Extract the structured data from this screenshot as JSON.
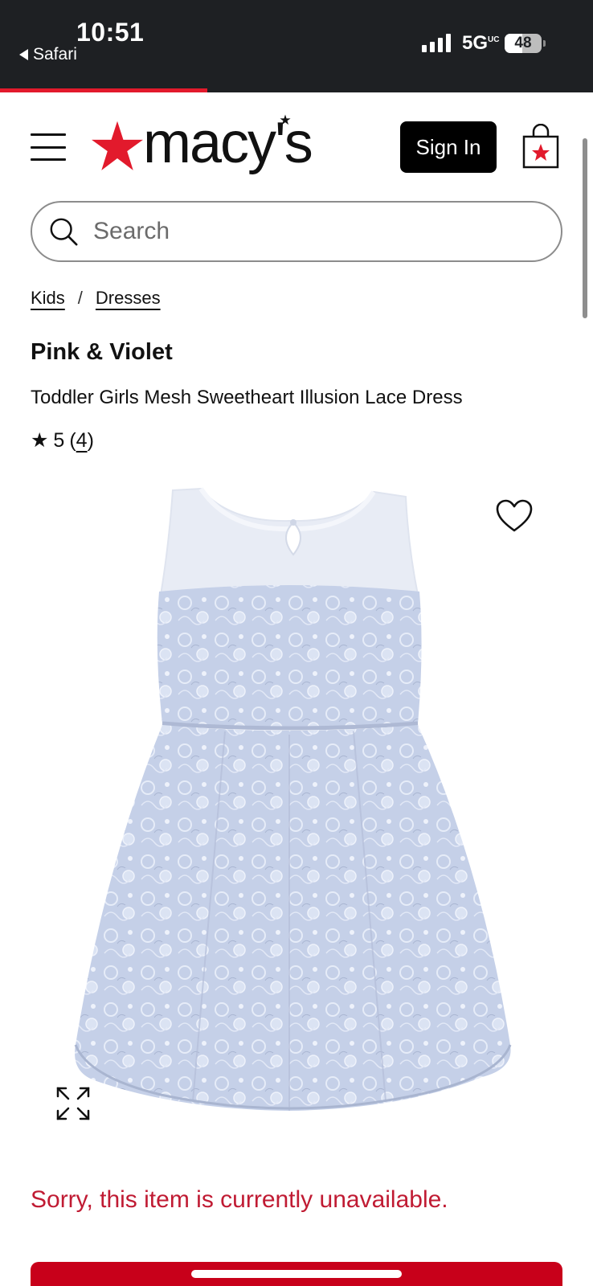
{
  "status_bar": {
    "time": "10:51",
    "back_label": "Safari",
    "network": "5G",
    "network_sup": "UC",
    "battery": "48",
    "battery_fraction": 0.48
  },
  "page_load_progress": 0.35,
  "header": {
    "menu_icon": "hamburger-menu-icon",
    "logo_text": "macy's",
    "brand_color": "#e21a2c",
    "signin_label": "Sign In",
    "bag_icon": "shopping-bag-icon"
  },
  "search": {
    "placeholder": "Search",
    "value": ""
  },
  "breadcrumb": {
    "items": [
      "Kids",
      "Dresses"
    ],
    "separator": "/"
  },
  "product": {
    "brand": "Pink & Violet",
    "name": "Toddler Girls Mesh Sweetheart Illusion Lace Dress",
    "rating_star": "★",
    "rating": "5",
    "review_count": "4",
    "image_icon": "light-blue-lace-dress-image",
    "wishlist_icon": "heart-outline-icon",
    "expand_icon": "expand-arrows-icon",
    "dress_color": "#c5d0e8"
  },
  "availability": {
    "message": "Sorry, this item is currently unavailable.",
    "color": "#c01b33"
  }
}
